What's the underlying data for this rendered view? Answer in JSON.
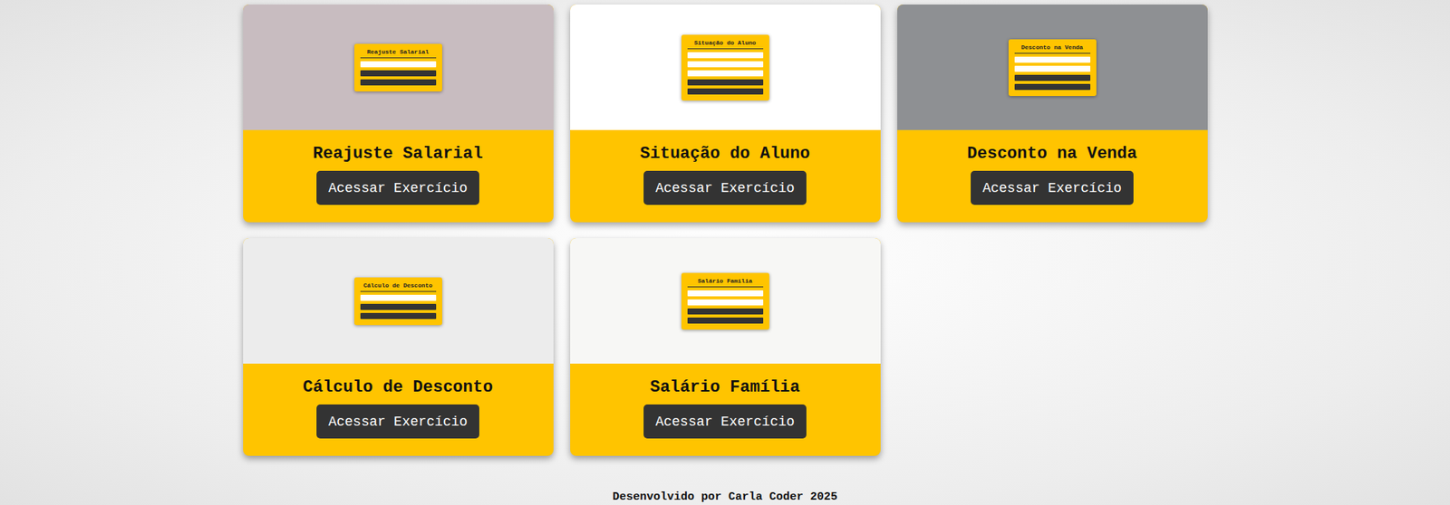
{
  "cards": [
    {
      "title": "Reajuste Salarial",
      "button": "Acessar Exercício",
      "preview": {
        "title": "Reajuste Salarial",
        "color": "#c8bcc0",
        "controls": [
          "input",
          "button",
          "button"
        ]
      }
    },
    {
      "title": "Situação do Aluno",
      "button": "Acessar Exercício",
      "preview": {
        "title": "Situação do Aluno",
        "color": "#ffffff",
        "controls": [
          "input",
          "input",
          "input",
          "button",
          "button"
        ]
      }
    },
    {
      "title": "Desconto na Venda",
      "button": "Acessar Exercício",
      "preview": {
        "title": "Desconto na Venda",
        "color": "#8e9093",
        "controls": [
          "input",
          "input",
          "button",
          "button"
        ]
      }
    },
    {
      "title": "Cálculo de Desconto",
      "button": "Acessar Exercício",
      "preview": {
        "title": "Cálculo de Desconto",
        "color": "#ececec",
        "controls": [
          "input",
          "button",
          "button"
        ]
      }
    },
    {
      "title": "Salário Família",
      "button": "Acessar Exercício",
      "preview": {
        "title": "Salário Família",
        "color": "#f7f7f5",
        "controls": [
          "input",
          "input",
          "button",
          "button"
        ]
      }
    }
  ],
  "footer": "Desenvolvido por Carla Coder 2025"
}
